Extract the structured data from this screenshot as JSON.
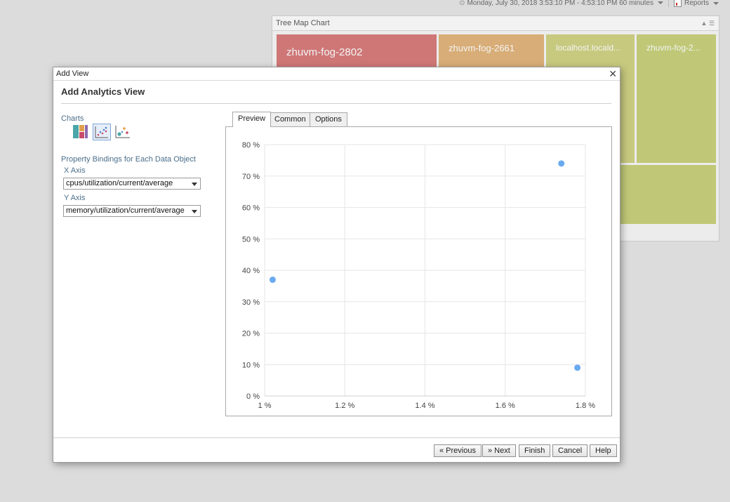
{
  "topbar": {
    "time_range": "Monday, July 30, 2018 3:53:10 PM - 4:53:10 PM 60 minutes",
    "reports": "Reports"
  },
  "treemap": {
    "title": "Tree Map Chart",
    "cells": [
      {
        "label": "zhuvm-fog-2802",
        "color": "#cf7777"
      },
      {
        "label": "zhuvm-fog-2661",
        "color": "#d8ad77"
      },
      {
        "label": "localhost.locald...",
        "color": "#c7c97f"
      },
      {
        "label": "zhuvm-fog-2...",
        "color": "#c0c877"
      },
      {
        "label": "",
        "color": "#c0c877"
      }
    ]
  },
  "dialog": {
    "window_title": "Add View",
    "heading": "Add Analytics View",
    "charts_label": "Charts",
    "chart_types": [
      {
        "icon": "treemap-chart-icon",
        "selected": false
      },
      {
        "icon": "scatter-chart-icon",
        "selected": true
      },
      {
        "icon": "bubble-chart-icon",
        "selected": false
      }
    ],
    "bindings_label": "Property Bindings for Each Data Object",
    "x_axis_label": "X Axis",
    "x_axis_value": "cpus/utilization/current/average",
    "y_axis_label": "Y Axis",
    "y_axis_value": "memory/utilization/current/average",
    "tabs": [
      {
        "label": "Preview",
        "active": true
      },
      {
        "label": "Common",
        "active": false
      },
      {
        "label": "Options",
        "active": false
      }
    ],
    "buttons": {
      "previous": "« Previous",
      "next": "» Next",
      "finish": "Finish",
      "cancel": "Cancel",
      "help": "Help"
    }
  },
  "chart_data": {
    "type": "scatter",
    "title": "",
    "xlabel": "",
    "ylabel": "",
    "xlim": [
      1.0,
      1.8
    ],
    "ylim": [
      0,
      80
    ],
    "x_ticks": [
      1.0,
      1.2,
      1.4,
      1.6,
      1.8
    ],
    "x_tick_labels": [
      "1 %",
      "1.2 %",
      "1.4 %",
      "1.6 %",
      "1.8 %"
    ],
    "y_ticks": [
      0,
      10,
      20,
      30,
      40,
      50,
      60,
      70,
      80
    ],
    "y_tick_labels": [
      "0 %",
      "10 %",
      "20 %",
      "30 %",
      "40 %",
      "50 %",
      "60 %",
      "70 %",
      "80 %"
    ],
    "grid": true,
    "point_color": "#6aaaf0",
    "series": [
      {
        "x": [
          1.02,
          1.74,
          1.78
        ],
        "y": [
          37,
          74,
          9
        ]
      }
    ]
  }
}
